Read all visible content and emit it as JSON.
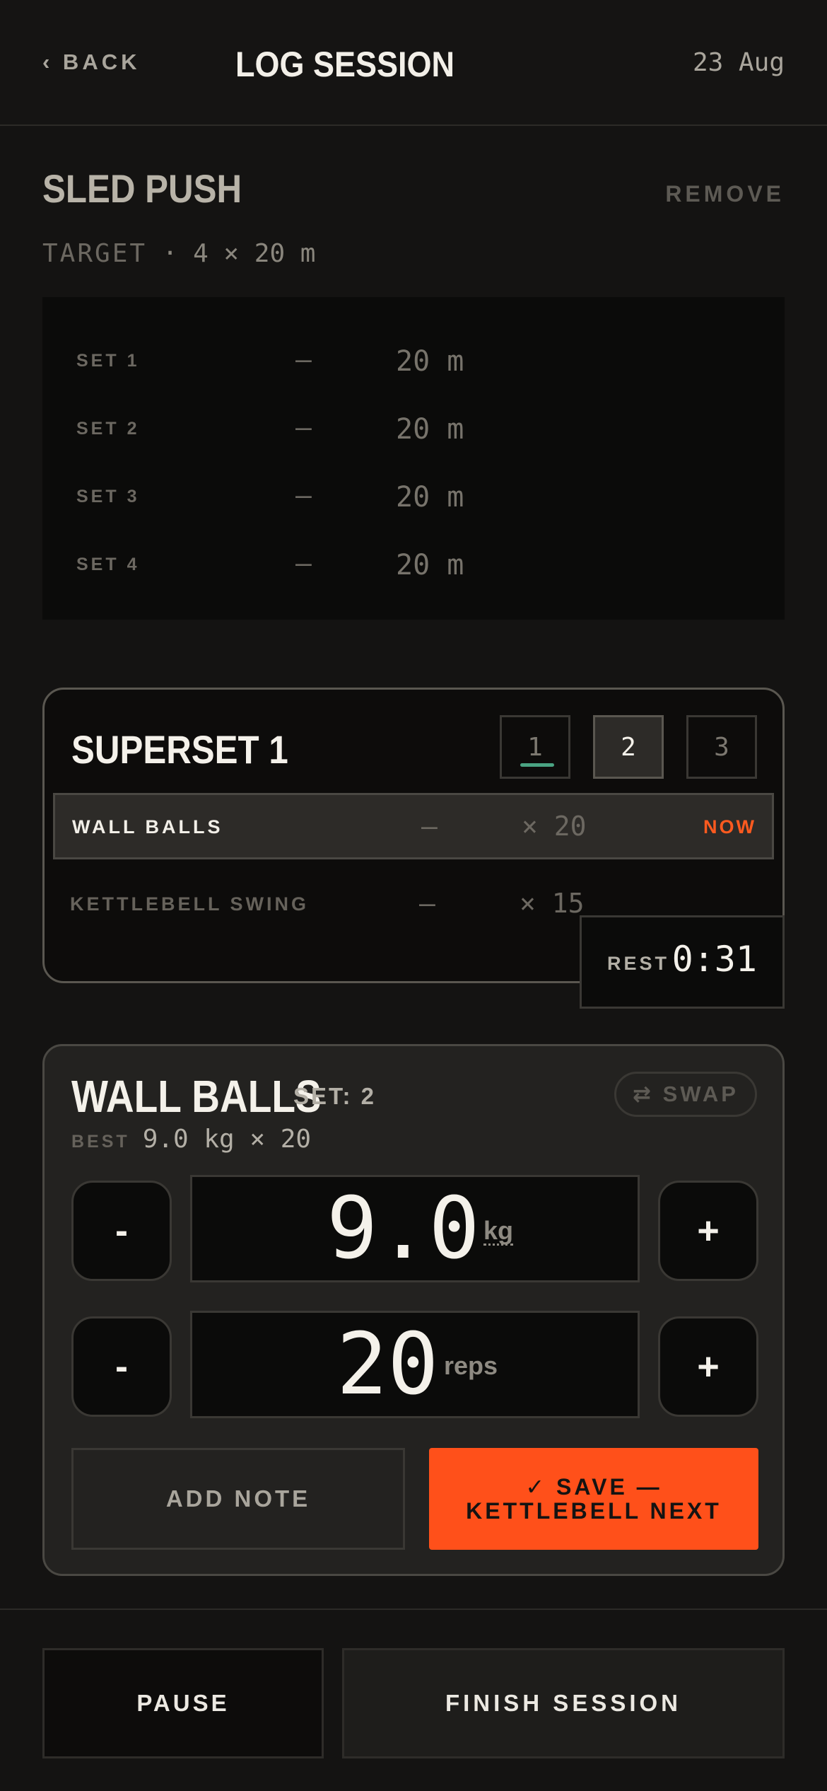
{
  "header": {
    "back_label": "‹ BACK",
    "title": "LOG SESSION",
    "date": "23 Aug"
  },
  "exercise": {
    "name": "SLED PUSH",
    "remove_label": "REMOVE",
    "target_label": "TARGET",
    "target_value": "· 4 × 20 m",
    "sets": [
      {
        "label": "SET 1",
        "weight": "—",
        "value": "20 m"
      },
      {
        "label": "SET 2",
        "weight": "—",
        "value": "20 m"
      },
      {
        "label": "SET 3",
        "weight": "—",
        "value": "20 m"
      },
      {
        "label": "SET 4",
        "weight": "—",
        "value": "20 m"
      }
    ]
  },
  "superset": {
    "title": "SUPERSET 1",
    "rounds": [
      "1",
      "2",
      "3"
    ],
    "active_round": "2",
    "items": [
      {
        "name": "WALL BALLS",
        "weight": "—",
        "reps": "× 20",
        "status": "NOW"
      },
      {
        "name": "KETTLEBELL SWING",
        "weight": "—",
        "reps": "× 15",
        "status": ""
      }
    ],
    "rest_label": "REST",
    "rest_time": "0:31"
  },
  "active": {
    "name": "WALL BALLS",
    "set_label": "SET: 2",
    "swap_label": "⇄ SWAP",
    "best_label": "BEST",
    "best_value": "9.0 kg × 20",
    "weight_value": "9.0",
    "weight_unit": "kg",
    "reps_value": "20",
    "reps_unit": "reps",
    "minus_label": "-",
    "plus_label": "+",
    "add_note_label": "ADD NOTE",
    "save_label": "✓ SAVE — KETTLEBELL NEXT"
  },
  "footer": {
    "pause_label": "PAUSE",
    "finish_label": "FINISH SESSION"
  },
  "colors": {
    "accent": "#ff501a",
    "progress": "#4aa382"
  }
}
